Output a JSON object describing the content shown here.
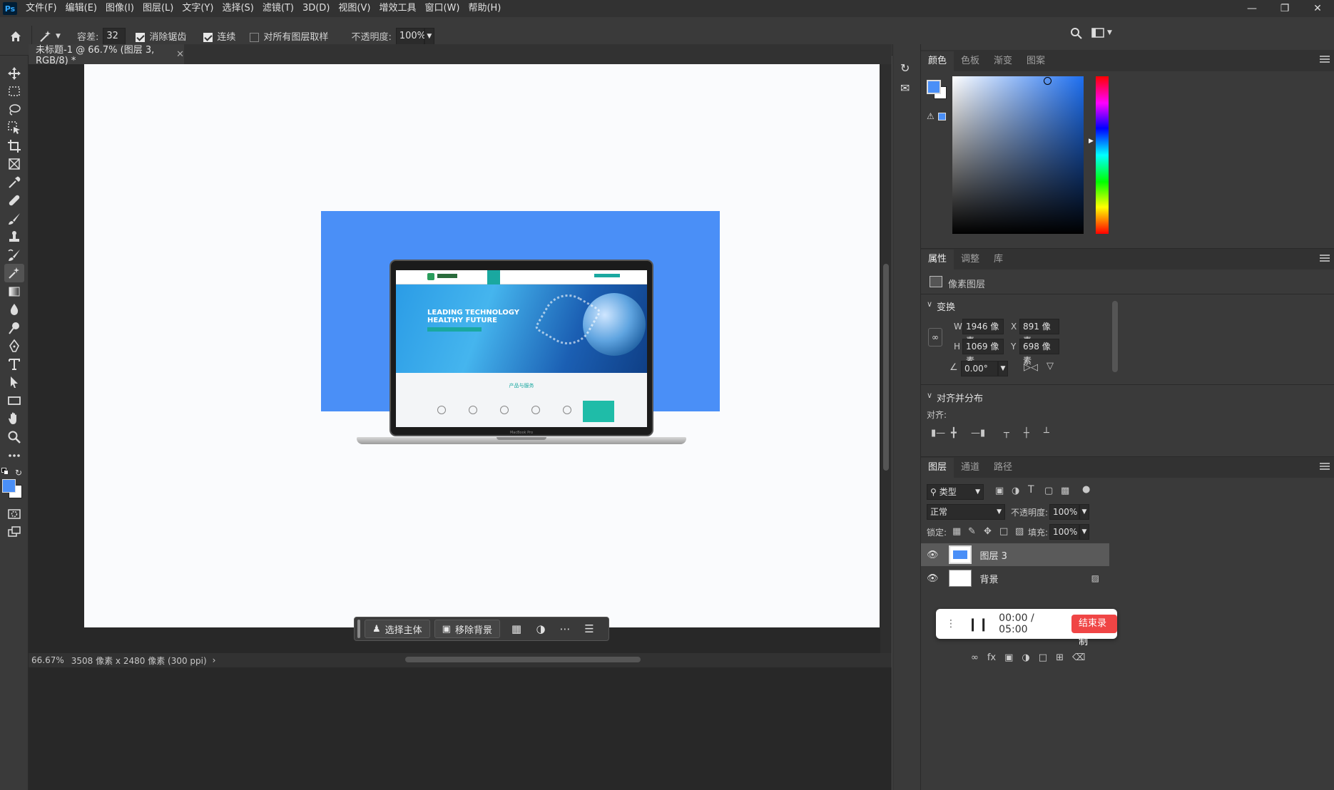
{
  "app": {
    "logo": "Ps"
  },
  "menu": [
    "文件(F)",
    "编辑(E)",
    "图像(I)",
    "图层(L)",
    "文字(Y)",
    "选择(S)",
    "滤镜(T)",
    "3D(D)",
    "视图(V)",
    "增效工具",
    "窗口(W)",
    "帮助(H)"
  ],
  "options": {
    "tolerance_label": "容差:",
    "tolerance_value": "32",
    "antialias_label": "消除锯齿",
    "contiguous_label": "连续",
    "sample_all_label": "对所有图层取样",
    "opacity_label": "不透明度:",
    "opacity_value": "100%"
  },
  "document": {
    "tab_title": "未标题-1 @ 66.7% (图层 3, RGB/8) *",
    "status_zoom": "66.67%",
    "status_info": "3508 像素 x 2480 像素 (300 ppi)",
    "status_arrow": "›"
  },
  "artwork": {
    "headline_1": "LEADING TECHNOLOGY",
    "headline_2": "HEALTHY FUTURE",
    "section_title": "产品与服务",
    "laptop_label": "MacBook Pro"
  },
  "context_bar": {
    "select_subject": "选择主体",
    "remove_bg": "移除背景"
  },
  "color_panel": {
    "tabs": [
      "颜色",
      "色板",
      "渐变",
      "图案"
    ],
    "fg_color": "#4a8ff7",
    "bg_color": "#ffffff"
  },
  "properties": {
    "tabs": [
      "属性",
      "调整",
      "库"
    ],
    "layer_type": "像素图层",
    "transform_title": "变换",
    "w_label": "W",
    "w_value": "1946 像素",
    "h_label": "H",
    "h_value": "1069 像素",
    "x_label": "X",
    "x_value": "891 像素",
    "y_label": "Y",
    "y_value": "698 像素",
    "angle_value": "0.00°",
    "align_title": "对齐并分布",
    "align_label": "对齐:"
  },
  "layers": {
    "tabs": [
      "图层",
      "通道",
      "路径"
    ],
    "filter_kind": "类型",
    "blend_mode": "正常",
    "opacity_label": "不透明度:",
    "opacity_value": "100%",
    "lock_label": "锁定:",
    "fill_label": "填充:",
    "fill_value": "100%",
    "items": [
      {
        "name": "图层 3"
      },
      {
        "name": "背景"
      }
    ]
  },
  "recording": {
    "time": "00:00 / 05:00",
    "end_label": "结束录制"
  }
}
